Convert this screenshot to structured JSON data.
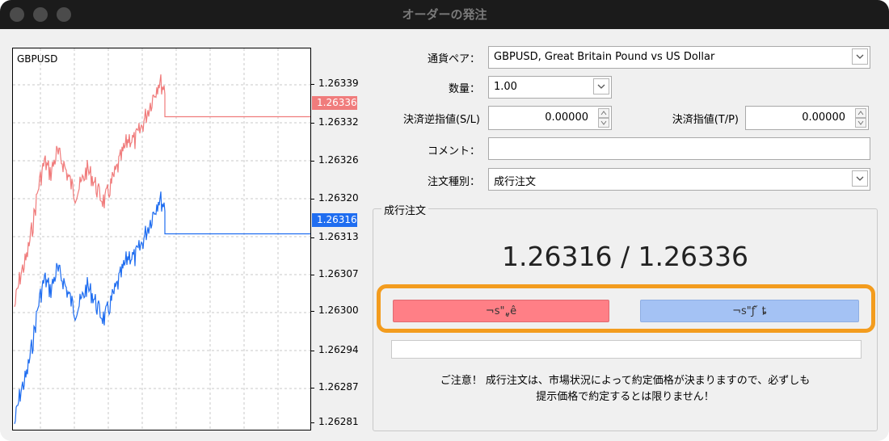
{
  "window": {
    "title": "オーダーの発注"
  },
  "chart": {
    "symbol": "GBPUSD",
    "y_labels": [
      "1.26339",
      "1.26336",
      "1.26332",
      "1.26326",
      "1.26320",
      "1.26316",
      "1.26313",
      "1.26307",
      "1.26300",
      "1.26294",
      "1.26287",
      "1.26281"
    ],
    "ask_tag": "1.26336",
    "bid_tag": "1.26316",
    "colors": {
      "ask": "#f07c7c",
      "bid": "#1f6df0",
      "ask_tag_bg": "#f07c7c",
      "bid_tag_bg": "#1f6df0"
    }
  },
  "form": {
    "symbol_label": "通貨ペア：",
    "symbol_value": "GBPUSD, Great Britain Pound vs US Dollar",
    "volume_label": "数量：",
    "volume_value": "1.00",
    "sl_label": "決済逆指値(S/L)",
    "sl_value": "0.00000",
    "tp_label": "決済指値(T/P)",
    "tp_value": "0.00000",
    "comment_label": "コメント：",
    "comment_value": "",
    "type_label": "注文種別：",
    "type_value": "成行注文"
  },
  "market": {
    "group_label": "成行注文",
    "prices": "1.26316 / 1.26336",
    "sell_label": "¬s\"„̥ê",
    "buy_label": "¬s\"ƒ ̌ ȶ",
    "sell_color": "#ff7f86",
    "buy_color": "#a4c2f4",
    "highlight_color": "#f39c1e",
    "notice_line1": "ご注意！ 成行注文は、市場状況によって約定価格が決まりますので、必ずしも",
    "notice_line2": "提示価格で約定するとは限りません！"
  }
}
